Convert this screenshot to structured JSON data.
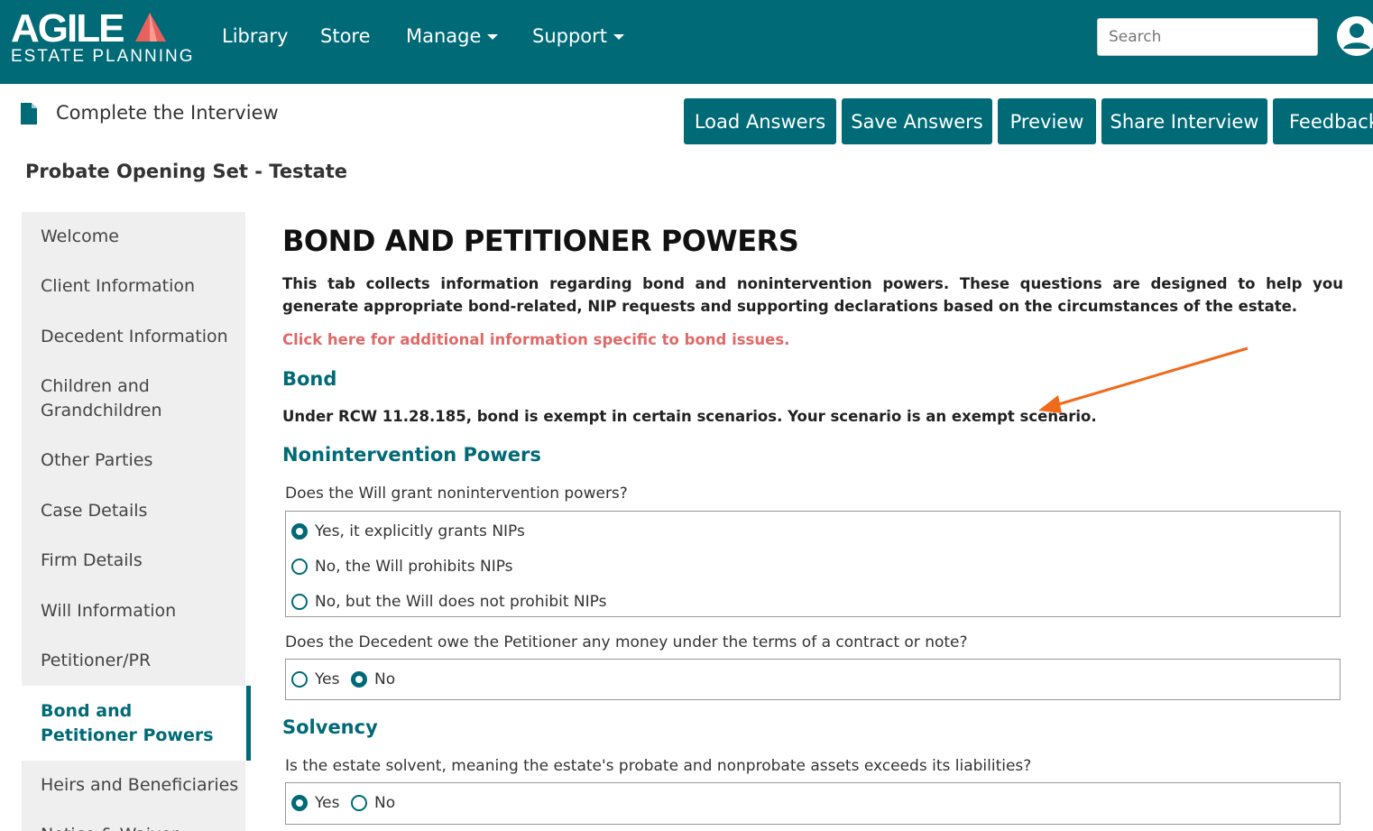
{
  "brand": {
    "name": "AGILE",
    "tagline": "ESTATE PLANNING",
    "accent_color": "#e8615c",
    "primary_color": "#006a77"
  },
  "nav": {
    "items": [
      {
        "label": "Library",
        "dropdown": false
      },
      {
        "label": "Store",
        "dropdown": false
      },
      {
        "label": "Manage",
        "dropdown": true
      },
      {
        "label": "Support",
        "dropdown": true
      }
    ],
    "search_placeholder": "Search",
    "user_icon": "user-circle-icon"
  },
  "header": {
    "title": "Complete the Interview",
    "icon": "document-icon"
  },
  "toolbar": {
    "buttons": [
      "Load Answers",
      "Save Answers",
      "Preview",
      "Share Interview",
      "Feedback"
    ]
  },
  "set_title": "Probate Opening Set - Testate",
  "sidebar": {
    "items": [
      "Welcome",
      "Client Information",
      "Decedent Information",
      "Children and Grandchildren",
      "Other Parties",
      "Case Details",
      "Firm Details",
      "Will Information",
      "Petitioner/PR",
      "Bond and Petitioner Powers",
      "Heirs and Beneficiaries",
      "Notice & Waiver"
    ],
    "active": "Bond and Petitioner Powers"
  },
  "main": {
    "title": "BOND AND PETITIONER POWERS",
    "intro": "This tab collects information regarding bond and nonintervention powers. These questions are designed to help you generate appropriate bond-related, NIP requests and supporting declarations based on the circumstances of the estate.",
    "info_link": "Click here for additional information specific to bond issues.",
    "bond_heading": "Bond",
    "bond_text": "Under RCW 11.28.185, bond is exempt in certain scenarios. Your scenario is an exempt scenario.",
    "nip_heading": "Nonintervention Powers",
    "q1": {
      "text": "Does the Will grant nonintervention powers?",
      "options": [
        "Yes, it explicitly grants NIPs",
        "No, the Will prohibits NIPs",
        "No, but the Will does not prohibit NIPs"
      ],
      "selected": "Yes, it explicitly grants NIPs"
    },
    "q2": {
      "text": "Does the Decedent owe the Petitioner any money under the terms of a contract or note?",
      "options": [
        "Yes",
        "No"
      ],
      "selected": "No"
    },
    "solvency_heading": "Solvency",
    "q3": {
      "text": "Is the estate solvent, meaning the estate's probate and nonprobate assets exceeds its liabilities?",
      "options": [
        "Yes",
        "No"
      ],
      "selected": "Yes"
    },
    "annotation_color": "#f06a1a"
  }
}
